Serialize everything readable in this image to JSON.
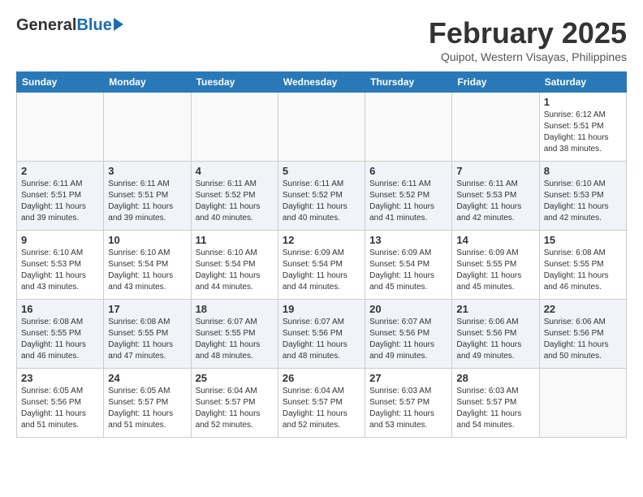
{
  "header": {
    "logo_general": "General",
    "logo_blue": "Blue",
    "month_title": "February 2025",
    "location": "Quipot, Western Visayas, Philippines"
  },
  "weekdays": [
    "Sunday",
    "Monday",
    "Tuesday",
    "Wednesday",
    "Thursday",
    "Friday",
    "Saturday"
  ],
  "weeks": [
    [
      {
        "day": "",
        "sunrise": "",
        "sunset": "",
        "daylight": ""
      },
      {
        "day": "",
        "sunrise": "",
        "sunset": "",
        "daylight": ""
      },
      {
        "day": "",
        "sunrise": "",
        "sunset": "",
        "daylight": ""
      },
      {
        "day": "",
        "sunrise": "",
        "sunset": "",
        "daylight": ""
      },
      {
        "day": "",
        "sunrise": "",
        "sunset": "",
        "daylight": ""
      },
      {
        "day": "",
        "sunrise": "",
        "sunset": "",
        "daylight": ""
      },
      {
        "day": "1",
        "sunrise": "Sunrise: 6:12 AM",
        "sunset": "Sunset: 5:51 PM",
        "daylight": "Daylight: 11 hours and 38 minutes."
      }
    ],
    [
      {
        "day": "2",
        "sunrise": "Sunrise: 6:11 AM",
        "sunset": "Sunset: 5:51 PM",
        "daylight": "Daylight: 11 hours and 39 minutes."
      },
      {
        "day": "3",
        "sunrise": "Sunrise: 6:11 AM",
        "sunset": "Sunset: 5:51 PM",
        "daylight": "Daylight: 11 hours and 39 minutes."
      },
      {
        "day": "4",
        "sunrise": "Sunrise: 6:11 AM",
        "sunset": "Sunset: 5:52 PM",
        "daylight": "Daylight: 11 hours and 40 minutes."
      },
      {
        "day": "5",
        "sunrise": "Sunrise: 6:11 AM",
        "sunset": "Sunset: 5:52 PM",
        "daylight": "Daylight: 11 hours and 40 minutes."
      },
      {
        "day": "6",
        "sunrise": "Sunrise: 6:11 AM",
        "sunset": "Sunset: 5:52 PM",
        "daylight": "Daylight: 11 hours and 41 minutes."
      },
      {
        "day": "7",
        "sunrise": "Sunrise: 6:11 AM",
        "sunset": "Sunset: 5:53 PM",
        "daylight": "Daylight: 11 hours and 42 minutes."
      },
      {
        "day": "8",
        "sunrise": "Sunrise: 6:10 AM",
        "sunset": "Sunset: 5:53 PM",
        "daylight": "Daylight: 11 hours and 42 minutes."
      }
    ],
    [
      {
        "day": "9",
        "sunrise": "Sunrise: 6:10 AM",
        "sunset": "Sunset: 5:53 PM",
        "daylight": "Daylight: 11 hours and 43 minutes."
      },
      {
        "day": "10",
        "sunrise": "Sunrise: 6:10 AM",
        "sunset": "Sunset: 5:54 PM",
        "daylight": "Daylight: 11 hours and 43 minutes."
      },
      {
        "day": "11",
        "sunrise": "Sunrise: 6:10 AM",
        "sunset": "Sunset: 5:54 PM",
        "daylight": "Daylight: 11 hours and 44 minutes."
      },
      {
        "day": "12",
        "sunrise": "Sunrise: 6:09 AM",
        "sunset": "Sunset: 5:54 PM",
        "daylight": "Daylight: 11 hours and 44 minutes."
      },
      {
        "day": "13",
        "sunrise": "Sunrise: 6:09 AM",
        "sunset": "Sunset: 5:54 PM",
        "daylight": "Daylight: 11 hours and 45 minutes."
      },
      {
        "day": "14",
        "sunrise": "Sunrise: 6:09 AM",
        "sunset": "Sunset: 5:55 PM",
        "daylight": "Daylight: 11 hours and 45 minutes."
      },
      {
        "day": "15",
        "sunrise": "Sunrise: 6:08 AM",
        "sunset": "Sunset: 5:55 PM",
        "daylight": "Daylight: 11 hours and 46 minutes."
      }
    ],
    [
      {
        "day": "16",
        "sunrise": "Sunrise: 6:08 AM",
        "sunset": "Sunset: 5:55 PM",
        "daylight": "Daylight: 11 hours and 46 minutes."
      },
      {
        "day": "17",
        "sunrise": "Sunrise: 6:08 AM",
        "sunset": "Sunset: 5:55 PM",
        "daylight": "Daylight: 11 hours and 47 minutes."
      },
      {
        "day": "18",
        "sunrise": "Sunrise: 6:07 AM",
        "sunset": "Sunset: 5:55 PM",
        "daylight": "Daylight: 11 hours and 48 minutes."
      },
      {
        "day": "19",
        "sunrise": "Sunrise: 6:07 AM",
        "sunset": "Sunset: 5:56 PM",
        "daylight": "Daylight: 11 hours and 48 minutes."
      },
      {
        "day": "20",
        "sunrise": "Sunrise: 6:07 AM",
        "sunset": "Sunset: 5:56 PM",
        "daylight": "Daylight: 11 hours and 49 minutes."
      },
      {
        "day": "21",
        "sunrise": "Sunrise: 6:06 AM",
        "sunset": "Sunset: 5:56 PM",
        "daylight": "Daylight: 11 hours and 49 minutes."
      },
      {
        "day": "22",
        "sunrise": "Sunrise: 6:06 AM",
        "sunset": "Sunset: 5:56 PM",
        "daylight": "Daylight: 11 hours and 50 minutes."
      }
    ],
    [
      {
        "day": "23",
        "sunrise": "Sunrise: 6:05 AM",
        "sunset": "Sunset: 5:56 PM",
        "daylight": "Daylight: 11 hours and 51 minutes."
      },
      {
        "day": "24",
        "sunrise": "Sunrise: 6:05 AM",
        "sunset": "Sunset: 5:57 PM",
        "daylight": "Daylight: 11 hours and 51 minutes."
      },
      {
        "day": "25",
        "sunrise": "Sunrise: 6:04 AM",
        "sunset": "Sunset: 5:57 PM",
        "daylight": "Daylight: 11 hours and 52 minutes."
      },
      {
        "day": "26",
        "sunrise": "Sunrise: 6:04 AM",
        "sunset": "Sunset: 5:57 PM",
        "daylight": "Daylight: 11 hours and 52 minutes."
      },
      {
        "day": "27",
        "sunrise": "Sunrise: 6:03 AM",
        "sunset": "Sunset: 5:57 PM",
        "daylight": "Daylight: 11 hours and 53 minutes."
      },
      {
        "day": "28",
        "sunrise": "Sunrise: 6:03 AM",
        "sunset": "Sunset: 5:57 PM",
        "daylight": "Daylight: 11 hours and 54 minutes."
      },
      {
        "day": "",
        "sunrise": "",
        "sunset": "",
        "daylight": ""
      }
    ]
  ]
}
